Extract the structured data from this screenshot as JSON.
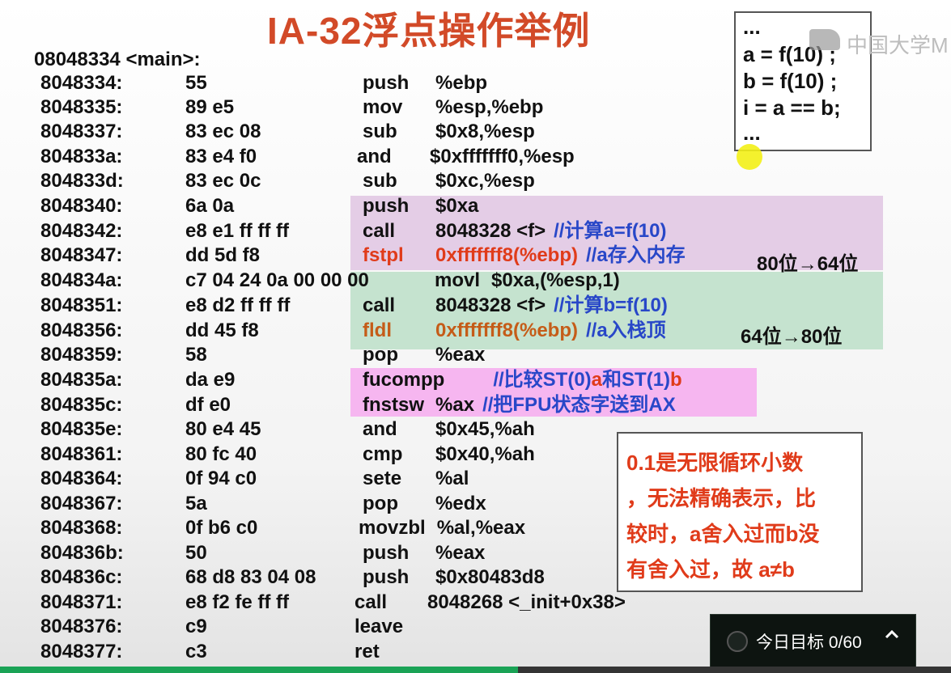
{
  "slide": {
    "title": "IA-32浮点操作举例",
    "function_label": "08048334 <main>:"
  },
  "listing": [
    {
      "addr": "8048334:",
      "hex": "55",
      "op": "push",
      "args": "%ebp",
      "comment": ""
    },
    {
      "addr": "8048335:",
      "hex": "89 e5",
      "op": "mov",
      "args": "%esp,%ebp",
      "comment": ""
    },
    {
      "addr": "8048337:",
      "hex": "83 ec 08",
      "op": "sub",
      "args": "$0x8,%esp",
      "comment": ""
    },
    {
      "addr": "804833a:",
      "hex": "83 e4 f0",
      "op": "and",
      "args": "$0xfffffff0,%esp",
      "comment": ""
    },
    {
      "addr": "804833d:",
      "hex": "83 ec 0c",
      "op": "sub",
      "args": "$0xc,%esp",
      "comment": ""
    },
    {
      "addr": "8048340:",
      "hex": "6a 0a",
      "op": "push",
      "args": "$0xa",
      "comment": ""
    },
    {
      "addr": "8048342:",
      "hex": "e8 e1 ff ff ff",
      "op": "call",
      "args": "8048328 <f>",
      "comment": "//计算a=f(10)"
    },
    {
      "addr": "8048347:",
      "hex": "dd 5d f8",
      "op": "fstpl",
      "args": "0xfffffff8(%ebp)",
      "comment": "//a存入内存"
    },
    {
      "addr": "804834a:",
      "hex": "c7 04 24 0a 00 00 00",
      "op": "movl",
      "args": "$0xa,(%esp,1)",
      "comment": ""
    },
    {
      "addr": "8048351:",
      "hex": "e8 d2 ff ff ff",
      "op": "call",
      "args": "8048328 <f>",
      "comment": "//计算b=f(10)"
    },
    {
      "addr": "8048356:",
      "hex": "dd 45 f8",
      "op": "fldl",
      "args": "0xfffffff8(%ebp)",
      "comment": "//a入栈顶"
    },
    {
      "addr": "8048359:",
      "hex": "58",
      "op": "pop",
      "args": "%eax",
      "comment": ""
    },
    {
      "addr": "804835a:",
      "hex": "da e9",
      "op": "fucompp",
      "args": "",
      "comment": "//比较ST(0)a和ST(1)b"
    },
    {
      "addr": "804835c:",
      "hex": "df e0",
      "op": "fnstsw",
      "args": "%ax",
      "comment": "//把FPU状态字送到AX"
    },
    {
      "addr": "804835e:",
      "hex": "80 e4 45",
      "op": "and",
      "args": "$0x45,%ah",
      "comment": ""
    },
    {
      "addr": "8048361:",
      "hex": "80 fc 40",
      "op": "cmp",
      "args": "$0x40,%ah",
      "comment": ""
    },
    {
      "addr": "8048364:",
      "hex": "0f 94 c0",
      "op": "sete",
      "args": "%al",
      "comment": ""
    },
    {
      "addr": "8048367:",
      "hex": "5a",
      "op": "pop",
      "args": "%edx",
      "comment": ""
    },
    {
      "addr": "8048368:",
      "hex": "0f b6 c0",
      "op": "movzbl",
      "args": "%al,%eax",
      "comment": ""
    },
    {
      "addr": "804836b:",
      "hex": "50",
      "op": "push",
      "args": "%eax",
      "comment": ""
    },
    {
      "addr": "804836c:",
      "hex": "68 d8 83 04 08",
      "op": "push",
      "args": "$0x80483d8",
      "comment": ""
    },
    {
      "addr": "8048371:",
      "hex": "e8 f2 fe ff ff",
      "op": "call",
      "args": "8048268 <_init+0x38>",
      "comment": ""
    },
    {
      "addr": "8048376:",
      "hex": "c9",
      "op": "leave",
      "args": "",
      "comment": ""
    },
    {
      "addr": "8048377:",
      "hex": "c3",
      "op": "ret",
      "args": "",
      "comment": ""
    }
  ],
  "side_notes": {
    "fstpl_note": "80位→64位",
    "fldl_note": "64位→80位"
  },
  "source_box": {
    "lines": [
      "...",
      "a = f(10) ;",
      "b = f(10) ;",
      "i = a == b;",
      "..."
    ]
  },
  "watermark": "中国大学M",
  "note_box": {
    "lines": [
      "0.1是无限循环小数",
      "，无法精确表示，比",
      "较时，a舍入过而b没",
      "有舍入过，故 a≠b"
    ]
  },
  "goal_widget": {
    "label": "今日目标 0/60",
    "chevron_icon": "chevron-up-icon"
  },
  "video_progress": {
    "fraction": 0.545
  },
  "colors": {
    "title": "#d24a28",
    "highlight_purple": "#e4cde6",
    "highlight_green": "#c5e3cf",
    "highlight_pink": "#f6b6f0",
    "comment_blue": "#2847c8",
    "instruction_red": "#e03b1a",
    "progress_green": "#1aa356"
  }
}
